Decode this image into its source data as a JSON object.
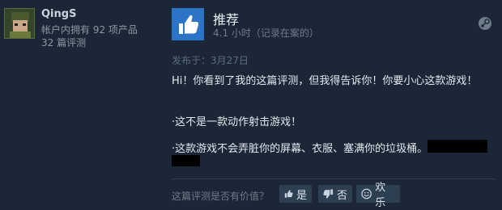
{
  "user": {
    "name": "QingS",
    "products_owned": "帐户内拥有 92 项产品",
    "reviews_count": "32 篇评测"
  },
  "review": {
    "verdict": "推荐",
    "hours": "4.1 小时（记录在案的）",
    "posted": "发布于：3月27日",
    "line1": "Hi！你看到了我的这篇评测，但我得告诉你！你要小心这款游戏！",
    "line2": "·这不是一款动作射击游戏！",
    "line3": "·这款游戏不会弄脏你的屏幕、衣服、塞满你的垃圾桶。"
  },
  "helpful": {
    "question": "这篇评测是否有价值？",
    "yes": "是",
    "no": "否",
    "funny": "欢乐"
  },
  "colors": {
    "background": "#1b2636",
    "recommend_blue": "#2b74c8",
    "button_bg": "#2f3f52"
  },
  "icons": [
    "thumbs-up-icon",
    "steam-icon",
    "thumbs-down-icon",
    "smile-icon"
  ]
}
